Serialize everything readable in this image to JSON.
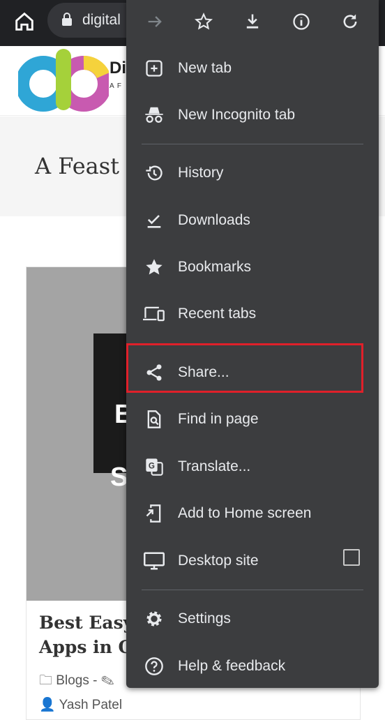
{
  "browser": {
    "url_text": "digital"
  },
  "page": {
    "brand": "Di",
    "tagline": "A F",
    "hero_title": "A Feast ",
    "thumb_letters": [
      "B",
      "S"
    ],
    "post_title": [
      "Best Easy",
      "Apps in O"
    ],
    "category": "Blogs",
    "separator": "-",
    "author": "Yash Patel"
  },
  "menu": {
    "toolbar": [
      "forward-icon",
      "star-icon",
      "download-icon",
      "info-icon",
      "refresh-icon"
    ],
    "items": [
      {
        "label": "New tab"
      },
      {
        "label": "New Incognito tab"
      },
      {
        "label": "History"
      },
      {
        "label": "Downloads"
      },
      {
        "label": "Bookmarks"
      },
      {
        "label": "Recent tabs"
      },
      {
        "label": "Share..."
      },
      {
        "label": "Find in page"
      },
      {
        "label": "Translate..."
      },
      {
        "label": "Add to Home screen"
      },
      {
        "label": "Desktop site",
        "checked": false
      },
      {
        "label": "Settings"
      },
      {
        "label": "Help & feedback"
      }
    ]
  },
  "colors": {
    "menu_bg": "#3c3d3f",
    "highlight": "#e0202a",
    "toolbar_bg": "#202124"
  }
}
